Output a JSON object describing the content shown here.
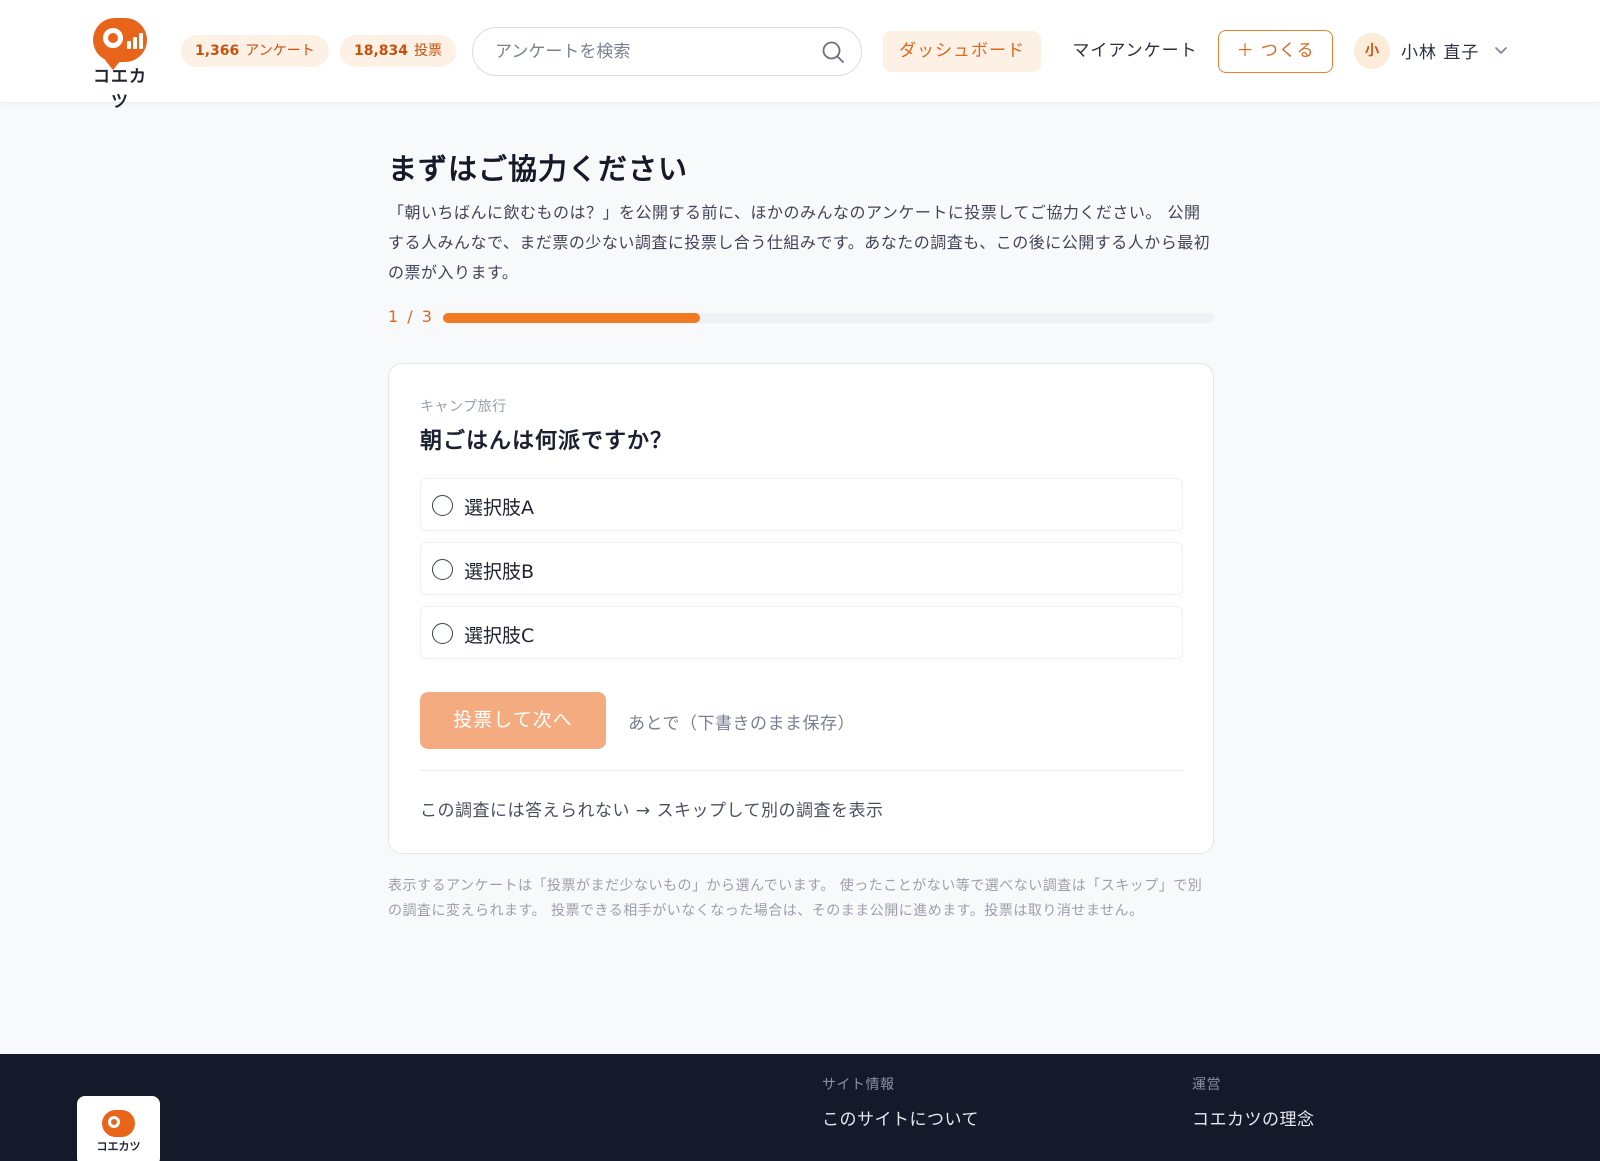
{
  "app": {
    "logo_text": "コエカツ",
    "colors": {
      "accent": "#f07a22",
      "accent_light": "#fdf1e6",
      "footer_bg": "#141a2a"
    }
  },
  "header": {
    "stats": [
      {
        "count": "1,366",
        "label": "アンケート"
      },
      {
        "count": "18,834",
        "label": "投票"
      }
    ],
    "search": {
      "placeholder": "アンケートを検索",
      "value": ""
    },
    "nav": {
      "dashboard": "ダッシュボード",
      "my_surveys": "マイアンケート",
      "create": "＋ つくる"
    },
    "user": {
      "avatar_initial": "小",
      "name": "小林 直子"
    }
  },
  "main": {
    "title": "まずはご協力ください",
    "intro": "「朝いちばんに飲むものは？」を公開する前に、ほかのみんなのアンケートに投票してご協力ください。 公開する人みんなで、まだ票の少ない調査に投票し合う仕組みです。あなたの調査も、この後に公開する人から最初の票が入ります。",
    "progress": {
      "label": "1 / 3",
      "current": 1,
      "total": 3
    },
    "card": {
      "category": "キャンプ旅行",
      "question": "朝ごはんは何派ですか？",
      "options": [
        "選択肢A",
        "選択肢B",
        "選択肢C"
      ],
      "vote_button": "投票して次へ",
      "later_link": "あとで（下書きのまま保存）",
      "skip_link": "この調査には答えられない → スキップして別の調査を表示"
    },
    "note": "表示するアンケートは「投票がまだ少ないもの」から選んでいます。 使ったことがない等で選べない調査は「スキップ」で別の調査に変えられます。 投票できる相手がいなくなった場合は、そのまま公開に進めます。投票は取り消せません。"
  },
  "footer": {
    "logo_text": "コエカツ",
    "columns": [
      {
        "heading": "サイト情報",
        "link": "このサイトについて"
      },
      {
        "heading": "運営",
        "link": "コエカツの理念"
      }
    ]
  }
}
